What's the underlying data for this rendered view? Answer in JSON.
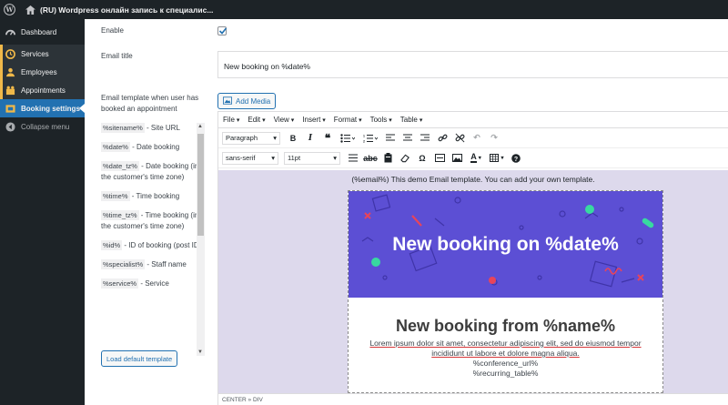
{
  "adminbar": {
    "site_title": "(RU) Wordpress онлайн запись к специалис..."
  },
  "sidebar": {
    "dashboard": "Dashboard",
    "items": [
      {
        "label": "Services"
      },
      {
        "label": "Employees"
      },
      {
        "label": "Appointments"
      },
      {
        "label": "Booking settings"
      }
    ],
    "collapse": "Collapse menu"
  },
  "form": {
    "enable_label": "Enable",
    "enable_checked": true,
    "email_title_label": "Email title",
    "email_title_value": "New booking on %date%",
    "template_label": "Email template when user has booked an appointment",
    "variables": [
      {
        "code": "%sitename%",
        "desc": " - Site URL"
      },
      {
        "code": "%date%",
        "desc": " - Date booking"
      },
      {
        "code": "%date_tz%",
        "desc": " - Date booking (in the customer's time zone)"
      },
      {
        "code": "%time%",
        "desc": " - Time booking"
      },
      {
        "code": "%time_tz%",
        "desc": " - Time booking (in the customer's time zone)"
      },
      {
        "code": "%id%",
        "desc": " - ID of booking (post ID)"
      },
      {
        "code": "%specialist%",
        "desc": " - Staff name"
      },
      {
        "code": "%service%",
        "desc": " - Service"
      }
    ],
    "load_default": "Load default template"
  },
  "editor": {
    "add_media": "Add Media",
    "menus": [
      "File",
      "Edit",
      "View",
      "Insert",
      "Format",
      "Tools",
      "Table"
    ],
    "format_select": "Paragraph",
    "font_select": "sans-serif",
    "size_select": "11pt",
    "demo_line": "(%email%) This demo Email template. You can add your own template.",
    "banner_title": "New booking on %date%",
    "heading": "New booking from %name%",
    "lorem": "Lorem ipsum dolor sit amet, consectetur adipiscing elit, sed do eiusmod tempor incididunt ut labore et dolore magna aliqua.",
    "conference": "%conference_url%",
    "recurring": "%recurring_table%",
    "status_path": "CENTER » DIV"
  },
  "colors": {
    "accent": "#2271b1",
    "banner": "#5c4fd4",
    "sidebar": "#1d2327",
    "marker": "#f0b849"
  }
}
